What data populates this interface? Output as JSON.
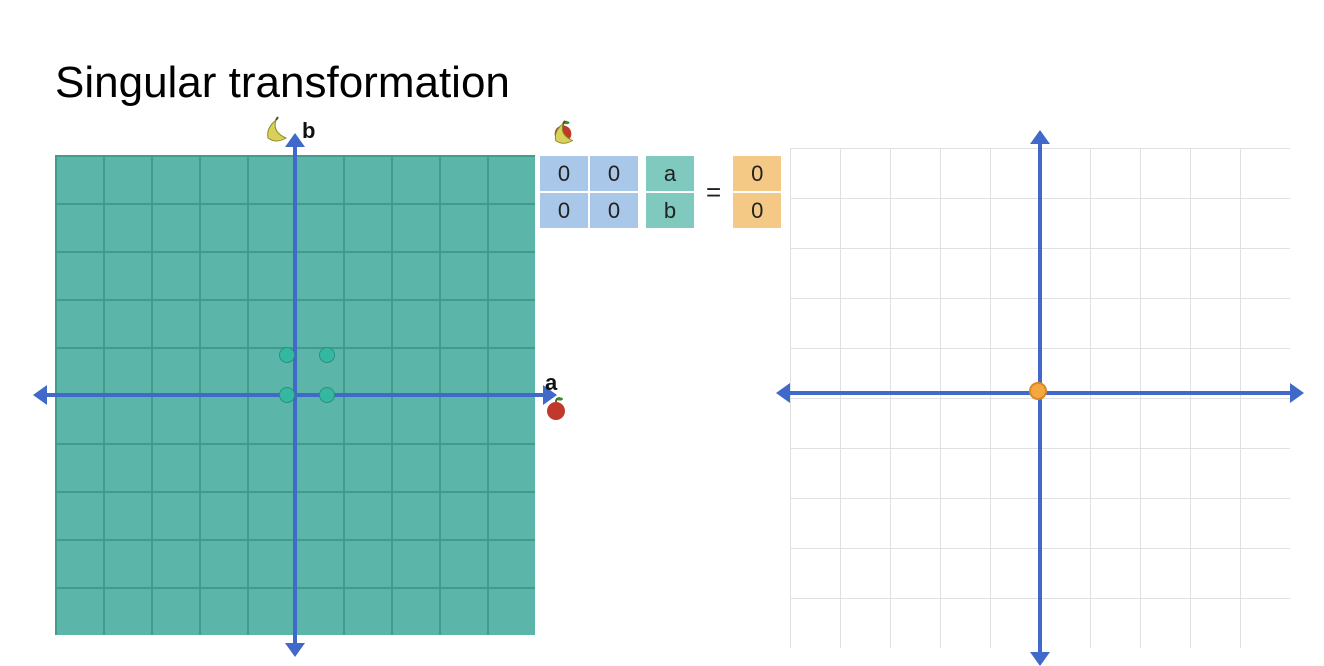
{
  "title": "Singular transformation",
  "left_grid": {
    "x_axis_label": "a",
    "y_axis_label": "b",
    "x_icon": "apple-icon",
    "y_icon": "banana-icon"
  },
  "equation": {
    "header_icons": [
      "apple-icon",
      "banana-icon"
    ],
    "matrix": [
      [
        "0",
        "0"
      ],
      [
        "0",
        "0"
      ]
    ],
    "vector": [
      "a",
      "b"
    ],
    "equals": "=",
    "result": [
      "0",
      "0"
    ]
  },
  "right_grid": {
    "origin_color": "#f5a742"
  },
  "chart_data": {
    "type": "diagram",
    "description": "Illustration of a singular (zero) 2×2 linear transformation collapsing the entire plane to the origin.",
    "matrix": [
      [
        0,
        0
      ],
      [
        0,
        0
      ]
    ],
    "input_vector": [
      "a",
      "b"
    ],
    "output_vector": [
      0,
      0
    ],
    "left_plane": {
      "xlim": [
        -5,
        5
      ],
      "ylim": [
        -5,
        5
      ],
      "fill": "full-plane-teal",
      "unit_square_handles": [
        [
          0,
          0
        ],
        [
          1,
          0
        ],
        [
          0,
          1
        ],
        [
          1,
          1
        ]
      ]
    },
    "right_plane": {
      "xlim": [
        -5,
        5
      ],
      "ylim": [
        -5,
        5
      ],
      "image_of_plane": "single point at origin"
    }
  }
}
